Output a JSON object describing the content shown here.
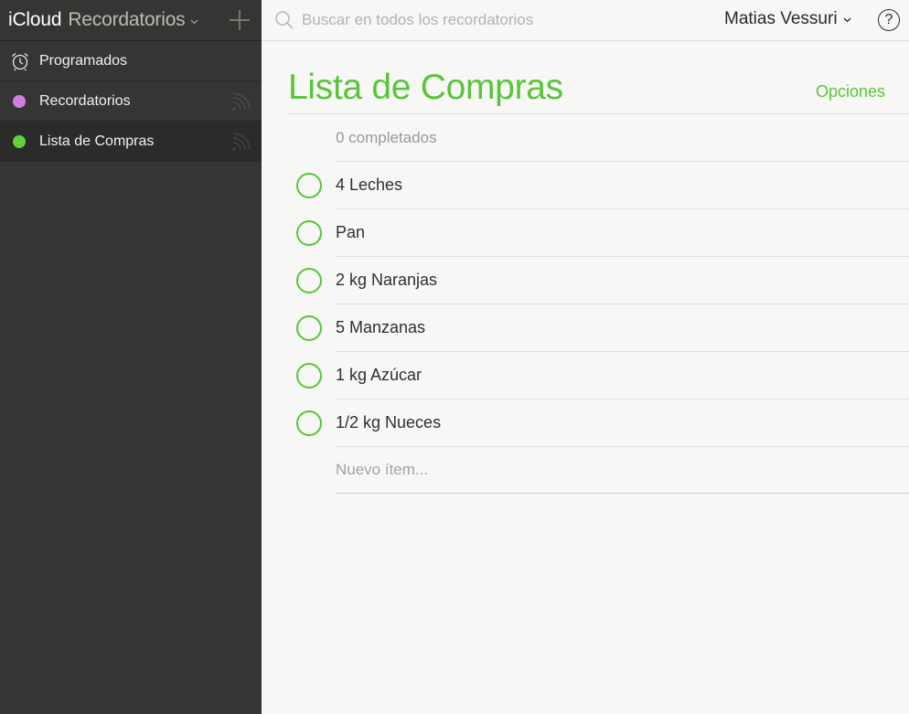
{
  "app": {
    "brand": "iCloud",
    "name": "Recordatorios"
  },
  "sidebar": {
    "items": [
      {
        "label": "Programados",
        "icon": "alarm-clock-icon"
      },
      {
        "label": "Recordatorios",
        "icon": "dot-icon",
        "color": "#d07fe0",
        "shared": true
      },
      {
        "label": "Lista de Compras",
        "icon": "dot-icon",
        "color": "#5ed33a",
        "shared": true,
        "selected": true
      }
    ]
  },
  "topbar": {
    "search_placeholder": "Buscar en todos los recordatorios",
    "user_name": "Matias Vessuri",
    "help_label": "?"
  },
  "list": {
    "title": "Lista de Compras",
    "options_label": "Opciones",
    "completed_label": "0 completados",
    "accent_color": "#5ac53b",
    "items": [
      {
        "text": "4 Leches"
      },
      {
        "text": "Pan"
      },
      {
        "text": "2 kg Naranjas"
      },
      {
        "text": "5 Manzanas"
      },
      {
        "text": "1 kg Azúcar"
      },
      {
        "text": "1/2 kg Nueces"
      }
    ],
    "new_item_placeholder": "Nuevo ítem..."
  }
}
